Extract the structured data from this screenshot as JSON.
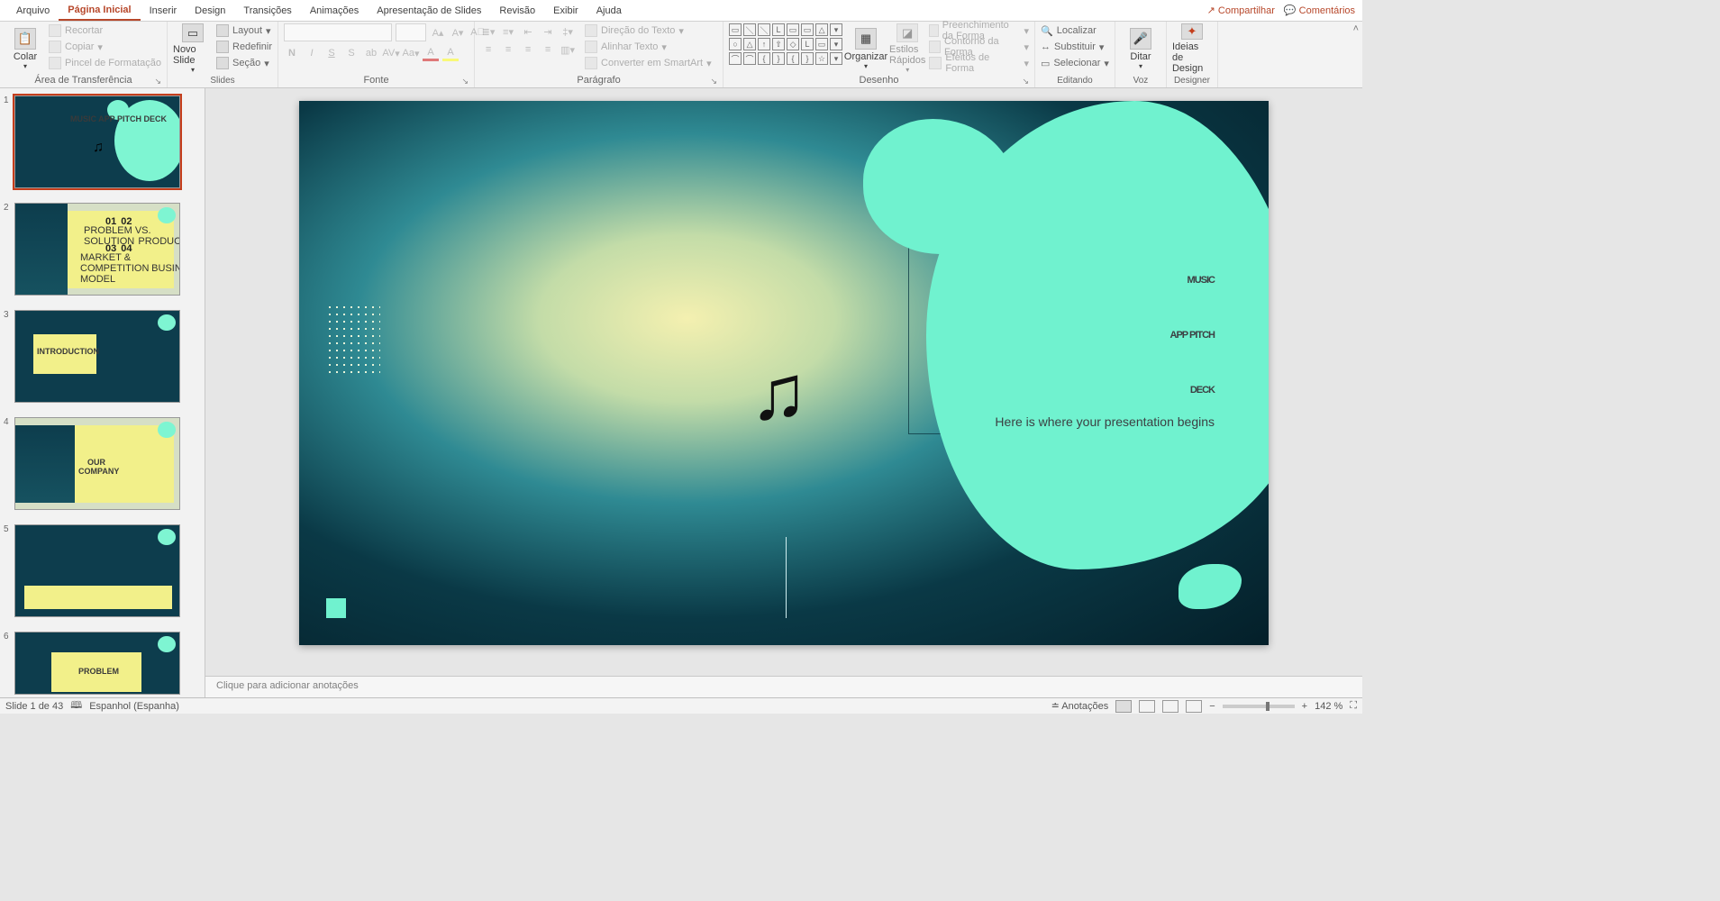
{
  "tabs": {
    "items": [
      "Arquivo",
      "Página Inicial",
      "Inserir",
      "Design",
      "Transições",
      "Animações",
      "Apresentação de Slides",
      "Revisão",
      "Exibir",
      "Ajuda"
    ],
    "active_index": 1,
    "share": "Compartilhar",
    "comments": "Comentários"
  },
  "ribbon": {
    "clipboard": {
      "paste": "Colar",
      "cut": "Recortar",
      "copy": "Copiar",
      "format_painter": "Pincel de Formatação",
      "label": "Área de Transferência"
    },
    "slides": {
      "new": "Novo Slide",
      "layout": "Layout",
      "reset": "Redefinir",
      "section": "Seção",
      "label": "Slides"
    },
    "font": {
      "label": "Fonte",
      "bold": "N",
      "italic": "I",
      "underline": "S",
      "strike": "S",
      "shadow": "ab",
      "spacing": "AV",
      "case": "Aa"
    },
    "paragraph": {
      "label": "Parágrafo",
      "text_dir": "Direção do Texto",
      "align_text": "Alinhar Texto",
      "smartart": "Converter em SmartArt"
    },
    "drawing": {
      "label": "Desenho",
      "arrange": "Organizar",
      "quick_styles": "Estilos Rápidos",
      "fill": "Preenchimento da Forma",
      "outline": "Contorno da Forma",
      "effects": "Efeitos de Forma"
    },
    "editing": {
      "label": "Editando",
      "find": "Localizar",
      "replace": "Substituir",
      "select": "Selecionar"
    },
    "voice": {
      "label": "Voz",
      "dictate": "Ditar"
    },
    "designer": {
      "label": "Designer",
      "ideas": "Ideias de Design"
    }
  },
  "thumbs": {
    "count": 6,
    "t1": "MUSIC APP PITCH DECK",
    "t2_01": "01",
    "t2_02": "02",
    "t2_03": "03",
    "t2_04": "04",
    "t2_a": "PROBLEM VS. SOLUTION",
    "t2_b": "PRODUCT",
    "t2_c": "MARKET & COMPETITION",
    "t2_d": "BUSINESS MODEL",
    "t3": "INTRODUCTION",
    "t4": "OUR COMPANY",
    "t6": "PROBLEM"
  },
  "slide": {
    "title_l1": "MUSIC",
    "title_l2": "APP PITCH",
    "title_l3": "DECK",
    "subtitle": "Here is where your presentation begins"
  },
  "notes": {
    "placeholder": "Clique para adicionar anotações"
  },
  "status": {
    "slide_of": "Slide 1 de 43",
    "lang": "Espanhol (Espanha)",
    "notes_btn": "Anotações",
    "zoom": "142 %"
  }
}
